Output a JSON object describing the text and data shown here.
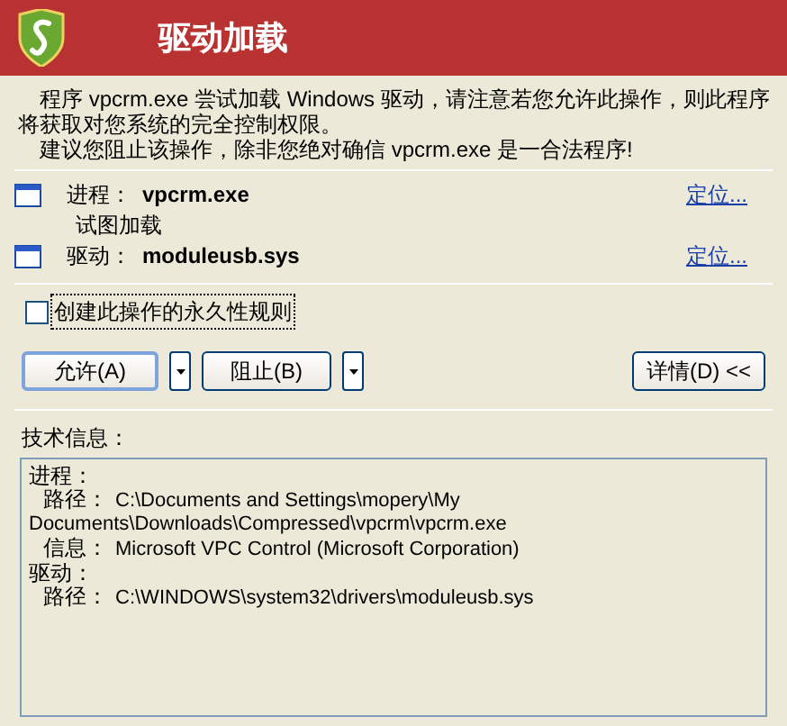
{
  "window": {
    "title": "驱动加载"
  },
  "message": [
    "程序 vpcrm.exe 尝试加载 Windows 驱动，请注意若您允许此操作，则此程序将获取对您系统的完全控制权限。",
    "建议您阻止该操作，除非您绝对确信  vpcrm.exe 是一合法程序!"
  ],
  "items": [
    {
      "label": "进程：",
      "name": "vpcrm.exe",
      "link": "定位...",
      "note": "试图加载"
    },
    {
      "label": "驱动：",
      "name": "moduleusb.sys",
      "link": "定位..."
    }
  ],
  "rule_checkbox": {
    "label": "创建此操作的永久性规则",
    "checked": false
  },
  "buttons": [
    {
      "label": "允许(A)",
      "default": true,
      "dropdown": true
    },
    {
      "label": "阻止(B)",
      "default": false,
      "dropdown": true
    },
    {
      "label": "详情(D) <<",
      "default": false,
      "dropdown": false
    }
  ],
  "tech_info": {
    "label": "技术信息：",
    "lines": [
      {
        "kind": "heading",
        "text": "进程："
      },
      {
        "kind": "field",
        "label": "路径：",
        "value": "C:\\Documents and Settings\\mopery\\My Documents\\Downloads\\Compressed\\vpcrm\\vpcrm.exe"
      },
      {
        "kind": "field",
        "label": "信息：",
        "value": "Microsoft VPC Control (Microsoft Corporation)"
      },
      {
        "kind": "heading",
        "text": "驱动："
      },
      {
        "kind": "field",
        "label": "路径：",
        "value": "C:\\WINDOWS\\system32\\drivers\\moduleusb.sys"
      }
    ]
  }
}
